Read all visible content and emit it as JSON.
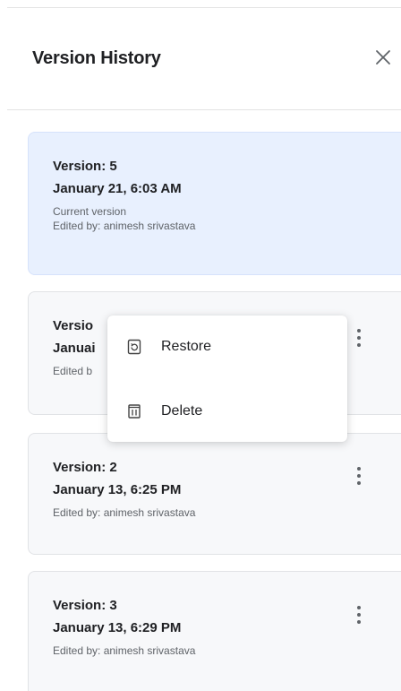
{
  "panel": {
    "title": "Version History",
    "close_icon": "close-icon"
  },
  "versions": [
    {
      "version": "Version: 5",
      "date": "January 21, 6:03 AM",
      "status": "Current version",
      "edited_by": "Edited by: animesh srivastava",
      "current": true
    },
    {
      "version": "Versio",
      "date": "Januai",
      "edited_by": "Edited b",
      "current": false
    },
    {
      "version": "Version: 2",
      "date": "January 13, 6:25 PM",
      "edited_by": "Edited by: animesh srivastava",
      "current": false
    },
    {
      "version": "Version: 3",
      "date": "January 13, 6:29 PM",
      "edited_by": "Edited by: animesh srivastava",
      "current": false
    }
  ],
  "context_menu": {
    "items": [
      {
        "label": "Restore",
        "icon": "restore-icon"
      },
      {
        "label": "Delete",
        "icon": "trash-icon"
      }
    ]
  },
  "colors": {
    "current_card_bg": "#e8f0fe",
    "card_bg": "#f7f8fa",
    "text": "#202124",
    "meta_text": "#5f6368"
  }
}
